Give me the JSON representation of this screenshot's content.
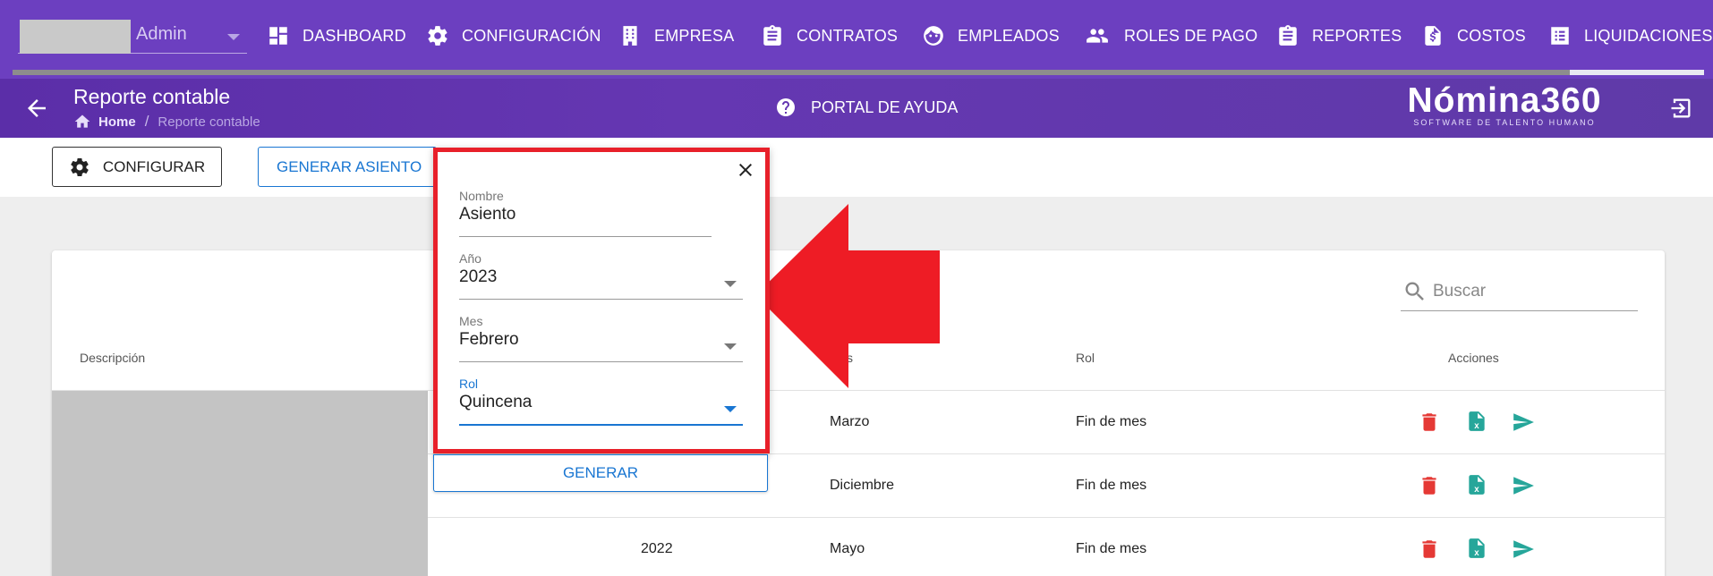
{
  "user": {
    "name": "Admin"
  },
  "nav": {
    "items": [
      {
        "label": "DASHBOARD",
        "icon": "dashboard-icon"
      },
      {
        "label": "CONFIGURACIÓN",
        "icon": "gear-icon"
      },
      {
        "label": "EMPRESA",
        "icon": "building-icon"
      },
      {
        "label": "CONTRATOS",
        "icon": "clipboard-icon"
      },
      {
        "label": "EMPLEADOS",
        "icon": "face-icon"
      },
      {
        "label": "ROLES DE PAGO",
        "icon": "people-icon"
      },
      {
        "label": "REPORTES",
        "icon": "clipboard-icon"
      },
      {
        "label": "COSTOS",
        "icon": "invoice-dollar-icon"
      },
      {
        "label": "LIQUIDACIONES",
        "icon": "list-icon"
      }
    ]
  },
  "header": {
    "title": "Reporte contable",
    "breadcrumb": {
      "home": "Home",
      "separator": "/",
      "current": "Reporte contable"
    },
    "help": "PORTAL DE AYUDA",
    "brand": {
      "name": "Nómina360",
      "tagline": "SOFTWARE DE TALENTO HUMANO"
    }
  },
  "toolbar": {
    "config_label": "CONFIGURAR",
    "generate_entry_label": "GENERAR ASIENTO"
  },
  "search": {
    "placeholder": "Buscar"
  },
  "table": {
    "headers": {
      "descripcion": "Descripción",
      "mes": "s",
      "rol": "Rol",
      "acciones": "Acciones"
    },
    "rows": [
      {
        "anio": "",
        "mes": "Marzo",
        "rol": "Fin de mes"
      },
      {
        "anio": "",
        "mes": "Diciembre",
        "rol": "Fin de mes"
      },
      {
        "anio": "2022",
        "mes": "Mayo",
        "rol": "Fin de mes"
      }
    ]
  },
  "popup": {
    "nombre": {
      "label": "Nombre",
      "value": "Asiento"
    },
    "anio": {
      "label": "Año",
      "value": "2023"
    },
    "mes": {
      "label": "Mes",
      "value": "Febrero"
    },
    "rol": {
      "label": "Rol",
      "value": "Quincena"
    },
    "generate_label": "GENERAR"
  },
  "colors": {
    "nav_bg": "#6c3fc0",
    "accent": "#1976d2",
    "highlight": "#e8202a",
    "delete": "#e53935",
    "excel": "#26a69a"
  }
}
